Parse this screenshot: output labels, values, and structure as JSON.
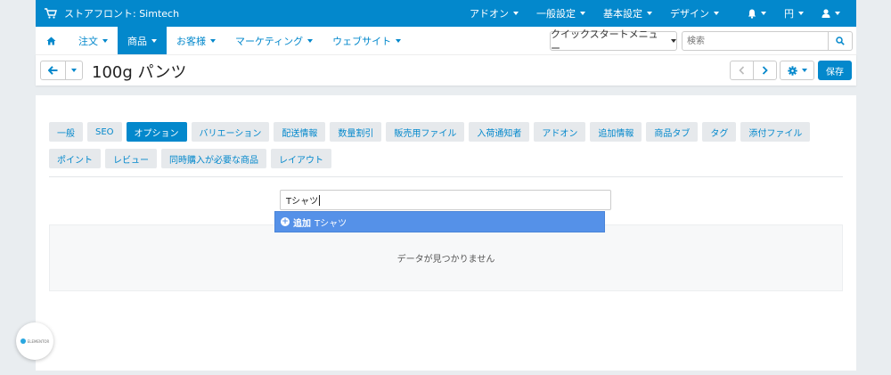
{
  "topbar": {
    "store_label": "ストアフロント: Simtech",
    "menus": [
      "アドオン",
      "一般設定",
      "基本設定",
      "デザイン"
    ],
    "currency": "円"
  },
  "navbar": {
    "items": [
      "注文",
      "商品",
      "お客様",
      "マーケティング",
      "ウェブサイト"
    ],
    "active_item": "商品",
    "quickstart_label": "クイックスタートメニュー",
    "search_placeholder": "検索"
  },
  "titlebar": {
    "title": "100g パンツ",
    "save_label": "保存"
  },
  "tabs": {
    "row1": [
      "一般",
      "SEO",
      "オプション",
      "バリエーション",
      "配送情報",
      "数量割引",
      "販売用ファイル",
      "入荷通知者",
      "アドオン",
      "追加情報",
      "商品タブ",
      "タグ",
      "添付ファイル"
    ],
    "row2": [
      "ポイント",
      "レビュー",
      "同時購入が必要な商品",
      "レイアウト"
    ],
    "active": "オプション"
  },
  "options": {
    "input_value": "Tシャツ",
    "suggestion_action": "追加",
    "suggestion_text": "Tシャツ",
    "empty_message": "データが見つかりません"
  },
  "widget": {
    "logo_text": "ELEMENTOR"
  },
  "colors": {
    "primary": "#0388cc",
    "suggestion": "#5591e8",
    "background": "#e9edf0"
  }
}
